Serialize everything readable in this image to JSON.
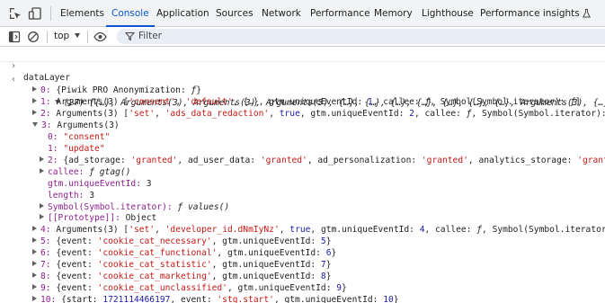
{
  "tabs": [
    "Elements",
    "Console",
    "Application",
    "Sources",
    "Network",
    "Performance",
    "Memory",
    "Lighthouse",
    "Performance insights"
  ],
  "active_tab": "Console",
  "toolbar": {
    "context": "top",
    "filter_placeholder": "Filter"
  },
  "colors": {
    "accent": "#0b57d0",
    "key": "#8e1f8e",
    "string": "#c41a16",
    "number": "#1a1aa6"
  },
  "console": {
    "input": "dataLayer",
    "summary": "(27) [{…}, Arguments(3), Arguments(3), Arguments(3), {…}, {…}, {…}, {…}, {…}, {…}, {…}, Arguments(3), {…}, {…}, {…}, {…}, {…}, {…}, push: ƒ]",
    "rows": [
      {
        "level": 1,
        "expander": "right",
        "text": "0: {Piwik PRO Anonymization: ƒ}"
      },
      {
        "level": 1,
        "expander": "right",
        "text": "1: Arguments(3) ['consent', 'default', {…}, gtm.uniqueEventId: 1, callee: ƒ, Symbol(Symbol.iterator): ƒ]"
      },
      {
        "level": 1,
        "expander": "right",
        "text": "2: Arguments(3) ['set', 'ads_data_redaction', true, gtm.uniqueEventId: 2, callee: ƒ, Symbol(Symbol.iterator): ƒ]"
      },
      {
        "level": 1,
        "expander": "down",
        "text": "3: Arguments(3)"
      },
      {
        "level": 2,
        "expander": "none",
        "text": "0: \"consent\""
      },
      {
        "level": 2,
        "expander": "none",
        "text": "1: \"update\""
      },
      {
        "level": 2,
        "expander": "right",
        "text": "2: {ad_storage: 'granted', ad_user_data: 'granted', ad_personalization: 'granted', analytics_storage: 'granted', functionality_storage: 'granted'}"
      },
      {
        "level": 2,
        "expander": "right",
        "text": "callee: ƒ gtag()"
      },
      {
        "level": 2,
        "expander": "none",
        "text": "gtm.uniqueEventId: 3"
      },
      {
        "level": 2,
        "expander": "none",
        "text": "length: 3"
      },
      {
        "level": 2,
        "expander": "right",
        "text": "Symbol(Symbol.iterator): ƒ values()"
      },
      {
        "level": 2,
        "expander": "right",
        "text": "[[Prototype]]: Object"
      },
      {
        "level": 1,
        "expander": "right",
        "text": "4: Arguments(3) ['set', 'developer_id.dNmIyNz', true, gtm.uniqueEventId: 4, callee: ƒ, Symbol(Symbol.iterator): ƒ]"
      },
      {
        "level": 1,
        "expander": "right",
        "text": "5: {event: 'cookie_cat_necessary', gtm.uniqueEventId: 5}"
      },
      {
        "level": 1,
        "expander": "right",
        "text": "6: {event: 'cookie_cat_functional', gtm.uniqueEventId: 6}"
      },
      {
        "level": 1,
        "expander": "right",
        "text": "7: {event: 'cookie_cat_statistic', gtm.uniqueEventId: 7}"
      },
      {
        "level": 1,
        "expander": "right",
        "text": "8: {event: 'cookie_cat_marketing', gtm.uniqueEventId: 8}"
      },
      {
        "level": 1,
        "expander": "right",
        "text": "9: {event: 'cookie_cat_unclassified', gtm.uniqueEventId: 9}"
      },
      {
        "level": 1,
        "expander": "right",
        "text": "10: {start: 1721114466197, event: 'stg.start', gtm.uniqueEventId: 10}"
      }
    ]
  }
}
